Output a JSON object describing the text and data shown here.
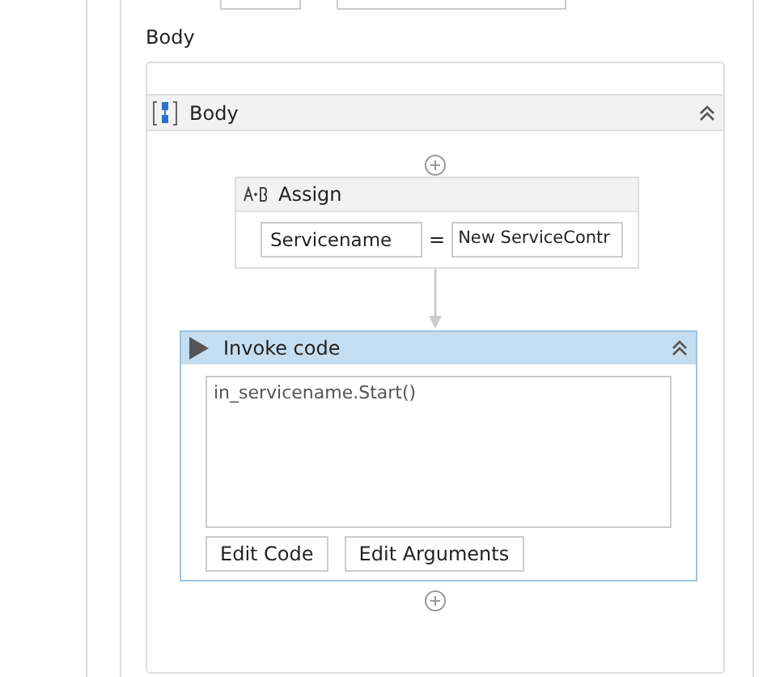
{
  "section_label": "Body",
  "sequence": {
    "title": "Body",
    "collapsed": false
  },
  "assign": {
    "title": "Assign",
    "to": "Servicename",
    "operator": "=",
    "value": "New ServiceContr"
  },
  "invoke_code": {
    "title": "Invoke code",
    "selected": true,
    "collapsed": false,
    "code": "in_servicename.Start()",
    "buttons": [
      "Edit Code",
      "Edit Arguments"
    ]
  }
}
